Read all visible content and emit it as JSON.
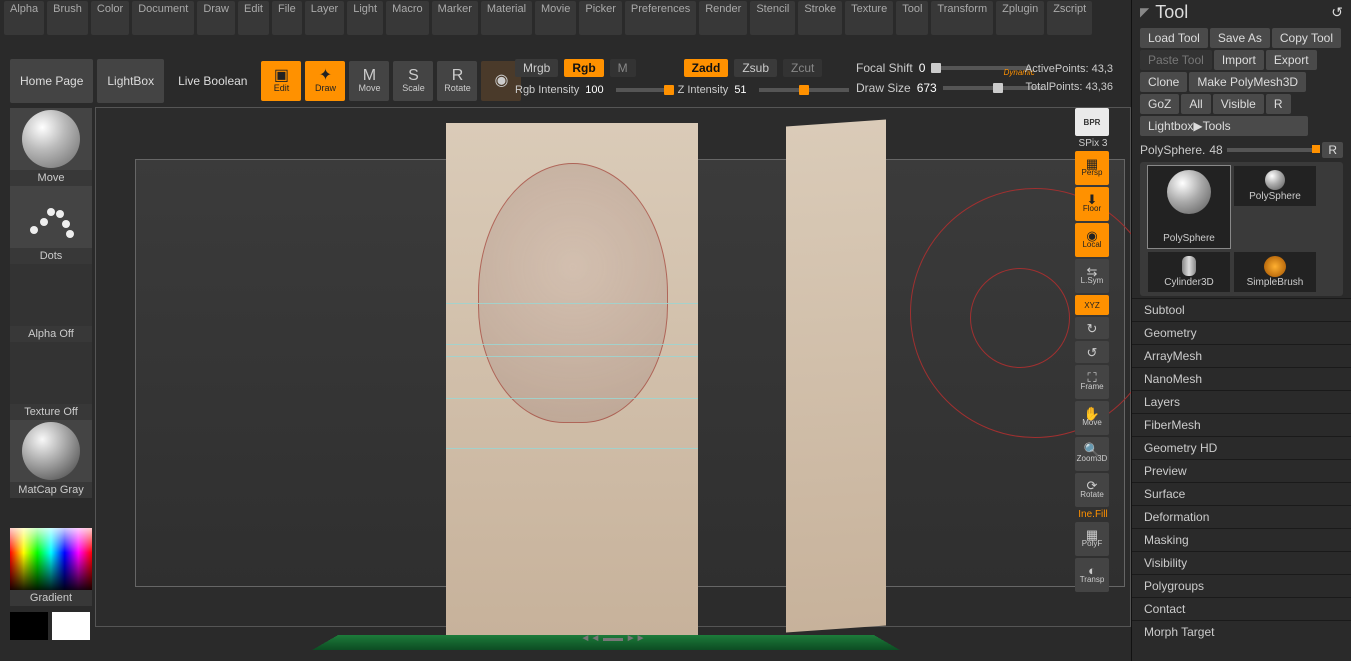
{
  "menu": [
    "Alpha",
    "Brush",
    "Color",
    "Document",
    "Draw",
    "Edit",
    "File",
    "Layer",
    "Light",
    "Macro",
    "Marker",
    "Material",
    "Movie",
    "Picker",
    "Preferences",
    "Render",
    "Stencil",
    "Stroke",
    "Texture",
    "Tool",
    "Transform",
    "Zplugin",
    "Zscript"
  ],
  "toolbar": {
    "home": "Home Page",
    "lightbox": "LightBox",
    "liveboolean": "Live Boolean",
    "edit": "Edit",
    "draw": "Draw",
    "move": "Move",
    "scale": "Scale",
    "rotate": "Rotate",
    "mrgb": "Mrgb",
    "rgb": "Rgb",
    "m": "M",
    "rgb_intensity_label": "Rgb Intensity",
    "rgb_intensity_value": "100",
    "zadd": "Zadd",
    "zsub": "Zsub",
    "zcut": "Zcut",
    "z_intensity_label": "Z Intensity",
    "z_intensity_value": "51",
    "focal_shift_label": "Focal Shift",
    "focal_shift_value": "0",
    "draw_size_label": "Draw Size",
    "draw_size_value": "673",
    "dynamic": "Dynamic"
  },
  "stats": {
    "active_label": "ActivePoints:",
    "active_value": "43,3",
    "total_label": "TotalPoints:",
    "total_value": "43,36"
  },
  "leftshelf": {
    "brush": "Move",
    "stroke": "Dots",
    "alpha": "Alpha Off",
    "texture": "Texture Off",
    "material": "MatCap Gray",
    "gradient": "Gradient"
  },
  "rightshelf": {
    "bpr": "BPR",
    "spix_label": "SPix",
    "spix_value": "3",
    "persp": "Persp",
    "floor": "Floor",
    "local": "Local",
    "lsym": "L.Sym",
    "xyz": "XYZ",
    "frame": "Frame",
    "move": "Move",
    "zoom": "Zoom3D",
    "rotate": "Rotate",
    "polyf": "PolyF",
    "transp": "Transp",
    "linefill": "Ine.Fill"
  },
  "rpanel": {
    "title": "Tool",
    "buttons": {
      "load": "Load Tool",
      "save": "Save As",
      "copy": "Copy Tool",
      "paste": "Paste Tool",
      "import": "Import",
      "export": "Export",
      "clone": "Clone",
      "makepoly": "Make PolyMesh3D",
      "goz": "GoZ",
      "all": "All",
      "visible": "Visible",
      "r1": "R",
      "lightbox_tools": "Lightbox▶Tools",
      "polysphere_label": "PolySphere.",
      "polysphere_num": "48",
      "r2": "R"
    },
    "thumbs": [
      "PolySphere",
      "PolySphere",
      "Cylinder3D",
      "SimpleBrush"
    ],
    "sections": [
      "Subtool",
      "Geometry",
      "ArrayMesh",
      "NanoMesh",
      "Layers",
      "FiberMesh",
      "Geometry HD",
      "Preview",
      "Surface",
      "Deformation",
      "Masking",
      "Visibility",
      "Polygroups",
      "Contact",
      "Morph Target"
    ]
  }
}
